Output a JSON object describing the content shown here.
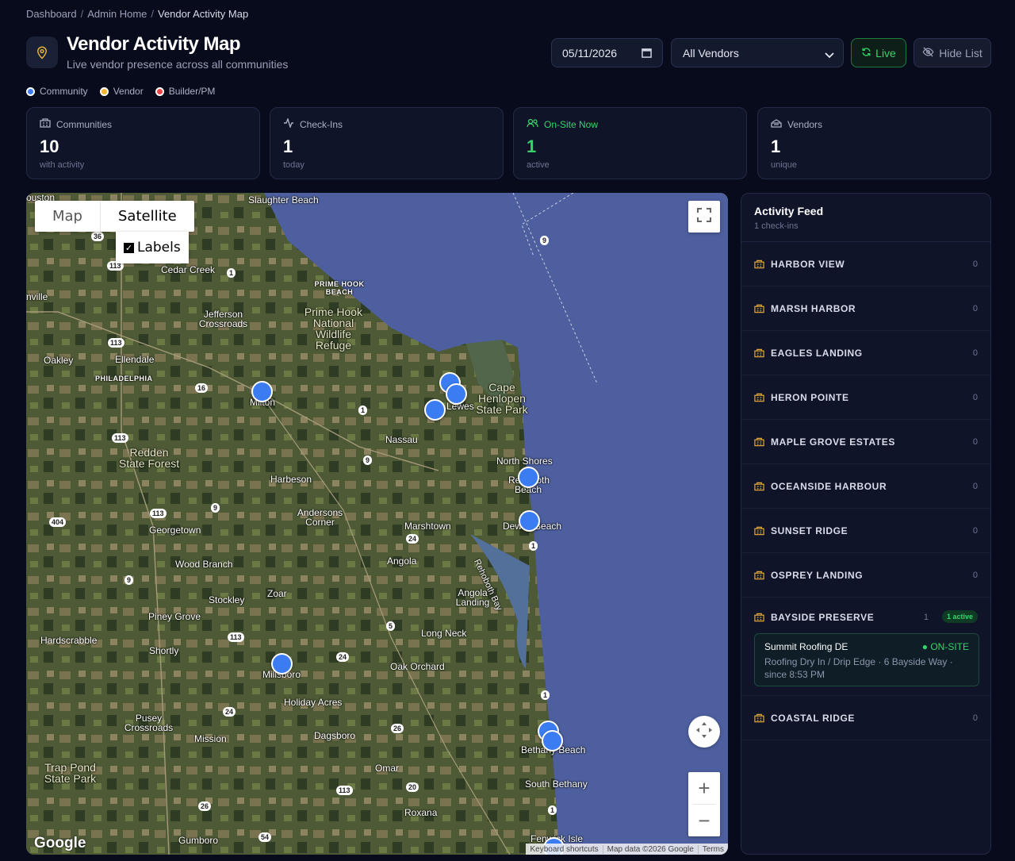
{
  "breadcrumb": {
    "items": [
      "Dashboard",
      "Admin Home"
    ],
    "current": "Vendor Activity Map"
  },
  "header": {
    "title": "Vendor Activity Map",
    "subtitle": "Live vendor presence across all communities"
  },
  "controls": {
    "date": "05/11/2026",
    "vendor_filter": "All Vendors",
    "live_label": "Live",
    "hide_list_label": "Hide List"
  },
  "legend": [
    {
      "label": "Community",
      "color": "#3b7cf2"
    },
    {
      "label": "Vendor",
      "color": "#f2b531"
    },
    {
      "label": "Builder/PM",
      "color": "#ef4444"
    }
  ],
  "stats": [
    {
      "label": "Communities",
      "value": "10",
      "sub": "with activity"
    },
    {
      "label": "Check-Ins",
      "value": "1",
      "sub": "today"
    },
    {
      "label": "On-Site Now",
      "value": "1",
      "sub": "active"
    },
    {
      "label": "Vendors",
      "value": "1",
      "sub": "unique"
    }
  ],
  "map": {
    "type_map": "Map",
    "type_satellite": "Satellite",
    "labels_toggle": "Labels",
    "google": "Google",
    "attribution": [
      "Keyboard shortcuts",
      "Map data ©2026 Google",
      "Terms"
    ],
    "places": {
      "slaughter": "Slaughter Beach",
      "cedar": "Cedar Creek",
      "primehook": "PRIME HOOK BEACH",
      "refuge": "Prime Hook National Wildlife Refuge",
      "jefferson": "Jefferson Crossroads",
      "oakley": "Oakley",
      "ellendale": "Ellendale",
      "philadelphia": "PHILADELPHIA",
      "milton": "Milton",
      "lewes": "Lewes",
      "capehenlopen": "Cape Henlopen State Park",
      "nassau": "Nassau",
      "redden": "Redden State Forest",
      "harbeson": "Harbeson",
      "northshores": "North Shores",
      "rehoboth": "Rehoboth Beach",
      "georgetown": "Georgetown",
      "andersons": "Andersons Corner",
      "marshtown": "Marshtown",
      "dewey": "Dewey Beach",
      "woodbranch": "Wood Branch",
      "angola": "Angola",
      "zoar": "Zoar",
      "stockley": "Stockley",
      "rehobothbay": "Rehoboth Bay",
      "angolalanding": "Angola Landing",
      "pineygrove": "Piney Grove",
      "hardscrabble": "Hardscrabble",
      "longneck": "Long Neck",
      "shortly": "Shortly",
      "millsboro": "Millsboro",
      "oakorchard": "Oak Orchard",
      "holidayacres": "Holiday Acres",
      "pusey": "Pusey Crossroads",
      "mission": "Mission",
      "dagsboro": "Dagsboro",
      "bethany": "Bethany Beach",
      "omar": "Omar",
      "trappond": "Trap Pond State Park",
      "southbethany": "South Bethany",
      "roxana": "Roxana",
      "gumboro": "Gumboro",
      "fenwick": "Fenwick Isle",
      "ville": "nville",
      "ouston": "ouston"
    }
  },
  "feed": {
    "title": "Activity Feed",
    "subtitle": "1 check-ins",
    "items": [
      {
        "name": "HARBOR VIEW",
        "count": "0"
      },
      {
        "name": "MARSH HARBOR",
        "count": "0"
      },
      {
        "name": "EAGLES LANDING",
        "count": "0"
      },
      {
        "name": "HERON POINTE",
        "count": "0"
      },
      {
        "name": "MAPLE GROVE ESTATES",
        "count": "0"
      },
      {
        "name": "OCEANSIDE HARBOUR",
        "count": "0"
      },
      {
        "name": "SUNSET RIDGE",
        "count": "0"
      },
      {
        "name": "OSPREY LANDING",
        "count": "0"
      },
      {
        "name": "BAYSIDE PRESERVE",
        "count": "1",
        "badge": "1 active",
        "checkin": {
          "vendor": "Summit Roofing DE",
          "status": "● ON-SITE",
          "detail": "Roofing Dry In / Drip Edge · 6 Bayside Way · since 8:53 PM"
        }
      },
      {
        "name": "COASTAL RIDGE",
        "count": "0"
      }
    ]
  }
}
